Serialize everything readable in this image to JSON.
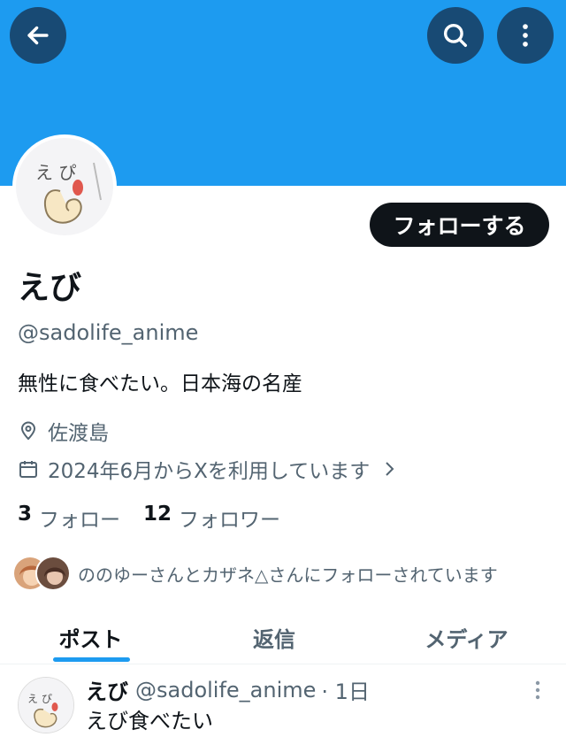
{
  "colors": {
    "banner": "#1d9bf0",
    "overlay_btn": "#184a74",
    "follow_btn_bg": "#0f1419",
    "muted": "#536471",
    "tab_indicator": "#1d9bf0"
  },
  "icons": {
    "back": "arrow-left-icon",
    "search": "search-icon",
    "more": "more-vertical-icon",
    "location": "location-pin-icon",
    "calendar": "calendar-icon",
    "chevron": "chevron-right-icon"
  },
  "profile": {
    "follow_label": "フォローする",
    "name": "えび",
    "handle": "@sadolife_anime",
    "bio": "無性に食べたい。日本海の名産",
    "location": "佐渡島",
    "joined": "2024年6月からXを利用しています",
    "following_count": "3",
    "following_label": "フォロー",
    "followers_count": "12",
    "followers_label": "フォロワー",
    "followed_by": "ののゆーさんとカザネ△さんにフォローされています"
  },
  "tabs": [
    {
      "label": "ポスト",
      "active": true
    },
    {
      "label": "返信",
      "active": false
    },
    {
      "label": "メディア",
      "active": false
    }
  ],
  "tweet": {
    "name": "えび",
    "handle": "@sadolife_anime",
    "time": "· 1日",
    "text": "えび食べたい"
  }
}
